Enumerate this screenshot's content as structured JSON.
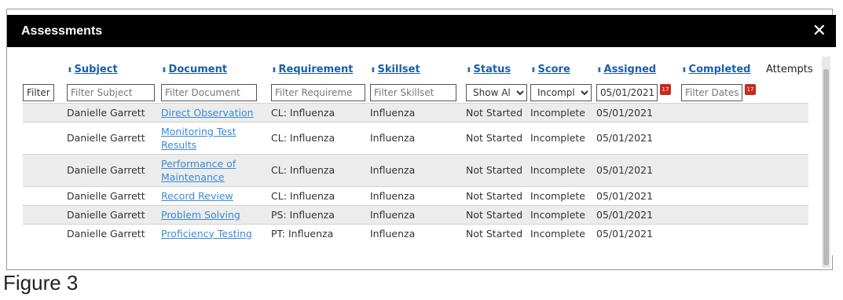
{
  "dialog": {
    "title": "Assessments",
    "close_icon": "close-icon"
  },
  "columns": {
    "subject": "Subject",
    "document": "Document",
    "requirement": "Requirement",
    "skillset": "Skillset",
    "status": "Status",
    "score": "Score",
    "assigned": "Assigned",
    "completed": "Completed",
    "attempts": "Attempts"
  },
  "filters": {
    "button_label": "Filter",
    "subject_placeholder": "Filter Subject",
    "document_placeholder": "Filter Document",
    "requirement_placeholder": "Filter Requireme",
    "skillset_placeholder": "Filter Skillset",
    "status_value": "Show Al",
    "score_value": "Incompl",
    "assigned_value": "05/01/2021",
    "completed_placeholder": "Filter Dates",
    "calendar_icon": "calendar-icon"
  },
  "rows": [
    {
      "subject": "Danielle Garrett",
      "document": "Direct Observation",
      "requirement": "CL: Influenza",
      "skillset": "Influenza",
      "status": "Not Started",
      "score": "Incomplete",
      "assigned": "05/01/2021"
    },
    {
      "subject": "Danielle Garrett",
      "document": "Monitoring Test Results",
      "requirement": "CL: Influenza",
      "skillset": "Influenza",
      "status": "Not Started",
      "score": "Incomplete",
      "assigned": "05/01/2021"
    },
    {
      "subject": "Danielle Garrett",
      "document": "Performance of Maintenance",
      "requirement": "CL: Influenza",
      "skillset": "Influenza",
      "status": "Not Started",
      "score": "Incomplete",
      "assigned": "05/01/2021"
    },
    {
      "subject": "Danielle Garrett",
      "document": "Record Review",
      "requirement": "CL: Influenza",
      "skillset": "Influenza",
      "status": "Not Started",
      "score": "Incomplete",
      "assigned": "05/01/2021"
    },
    {
      "subject": "Danielle Garrett",
      "document": "Problem Solving",
      "requirement": "PS: Influenza",
      "skillset": "Influenza",
      "status": "Not Started",
      "score": "Incomplete",
      "assigned": "05/01/2021"
    },
    {
      "subject": "Danielle Garrett",
      "document": "Proficiency Testing",
      "requirement": "PT: Influenza",
      "skillset": "Influenza",
      "status": "Not Started",
      "score": "Incomplete",
      "assigned": "05/01/2021"
    }
  ],
  "caption": "Figure 3"
}
